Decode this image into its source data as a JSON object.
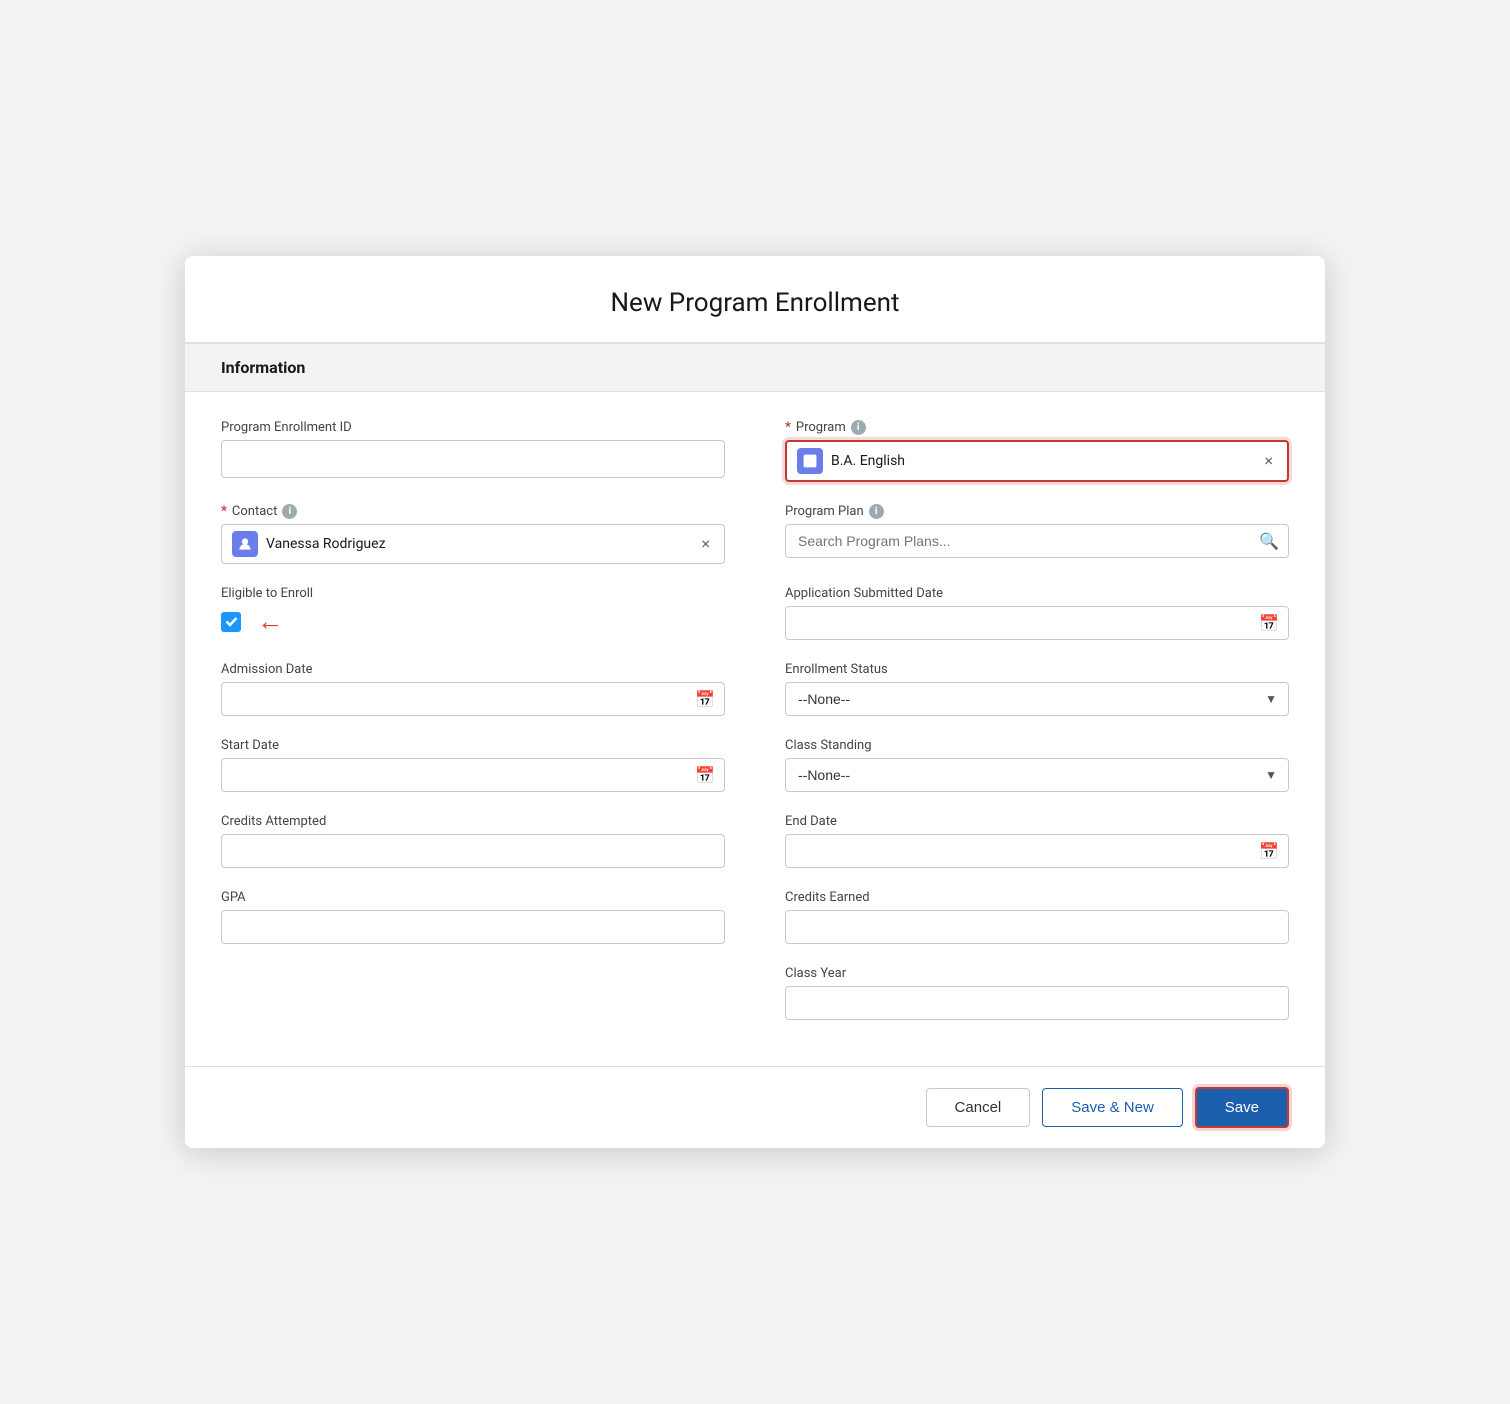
{
  "page": {
    "title": "New Program Enrollment"
  },
  "section": {
    "label": "Information"
  },
  "fields": {
    "program_enrollment_id": {
      "label": "Program Enrollment ID",
      "value": "",
      "placeholder": ""
    },
    "program": {
      "label": "Program",
      "required": true,
      "value": "B.A. English",
      "has_info": true
    },
    "contact": {
      "label": "Contact",
      "required": true,
      "value": "Vanessa Rodriguez",
      "has_info": true
    },
    "program_plan": {
      "label": "Program Plan",
      "placeholder": "Search Program Plans...",
      "has_info": true
    },
    "eligible_to_enroll": {
      "label": "Eligible to Enroll",
      "checked": true
    },
    "application_submitted_date": {
      "label": "Application Submitted Date",
      "value": ""
    },
    "admission_date": {
      "label": "Admission Date",
      "value": ""
    },
    "enrollment_status": {
      "label": "Enrollment Status",
      "value": "--None--",
      "options": [
        "--None--"
      ]
    },
    "start_date": {
      "label": "Start Date",
      "value": ""
    },
    "class_standing": {
      "label": "Class Standing",
      "value": "--None--",
      "options": [
        "--None--"
      ]
    },
    "credits_attempted": {
      "label": "Credits Attempted",
      "value": ""
    },
    "end_date": {
      "label": "End Date",
      "value": ""
    },
    "gpa": {
      "label": "GPA",
      "value": ""
    },
    "credits_earned": {
      "label": "Credits Earned",
      "value": ""
    },
    "class_year": {
      "label": "Class Year",
      "value": ""
    }
  },
  "footer": {
    "cancel_label": "Cancel",
    "save_new_label": "Save & New",
    "save_label": "Save"
  }
}
